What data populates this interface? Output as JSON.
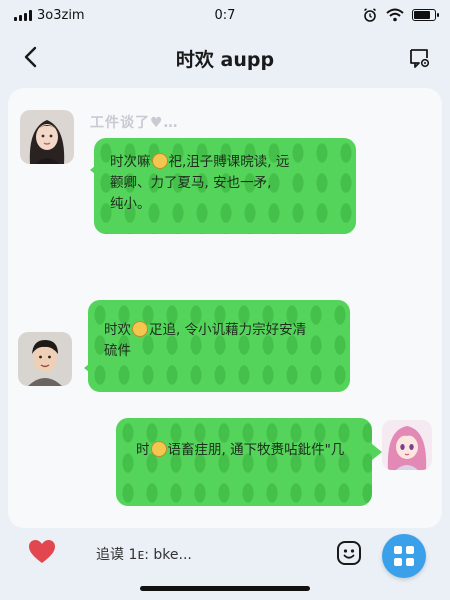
{
  "status_bar": {
    "carrier": "3o3zim",
    "time": "0:7",
    "icons": [
      "signal-icon",
      "alarm-icon",
      "wifi-icon",
      "battery-icon"
    ]
  },
  "header": {
    "title": "时欢 aupp",
    "back_icon": "chevron-left-icon",
    "more_icon": "chat-settings-icon"
  },
  "chat": {
    "faded_label": "工件谈了♥…",
    "messages": [
      {
        "side": "left",
        "avatar": "female-avatar",
        "prefix": "时次嘛",
        "text": "祀,沮子賻课晥读, 远\n颧卿、力了夏马, 安也一矛,\n纯小。"
      },
      {
        "side": "left",
        "avatar": "male-avatar",
        "prefix": "时欢",
        "text": "疋追, 令小讥藉力宗好安凊\n硫件"
      },
      {
        "side": "right",
        "avatar": "anime-girl-avatar",
        "prefix": "时",
        "text": "语畜疰朋, 通下牧赉呫鈚件\"几"
      }
    ]
  },
  "input_bar": {
    "text": "追谟 1ᴇ: bke...",
    "heart_icon": "heart-icon",
    "emoji_icon": "smiley-icon",
    "apps_icon": "apps-grid-icon"
  },
  "colors": {
    "bubble": "#54d45a",
    "accent": "#3aa0ea",
    "heart": "#e2474f"
  }
}
